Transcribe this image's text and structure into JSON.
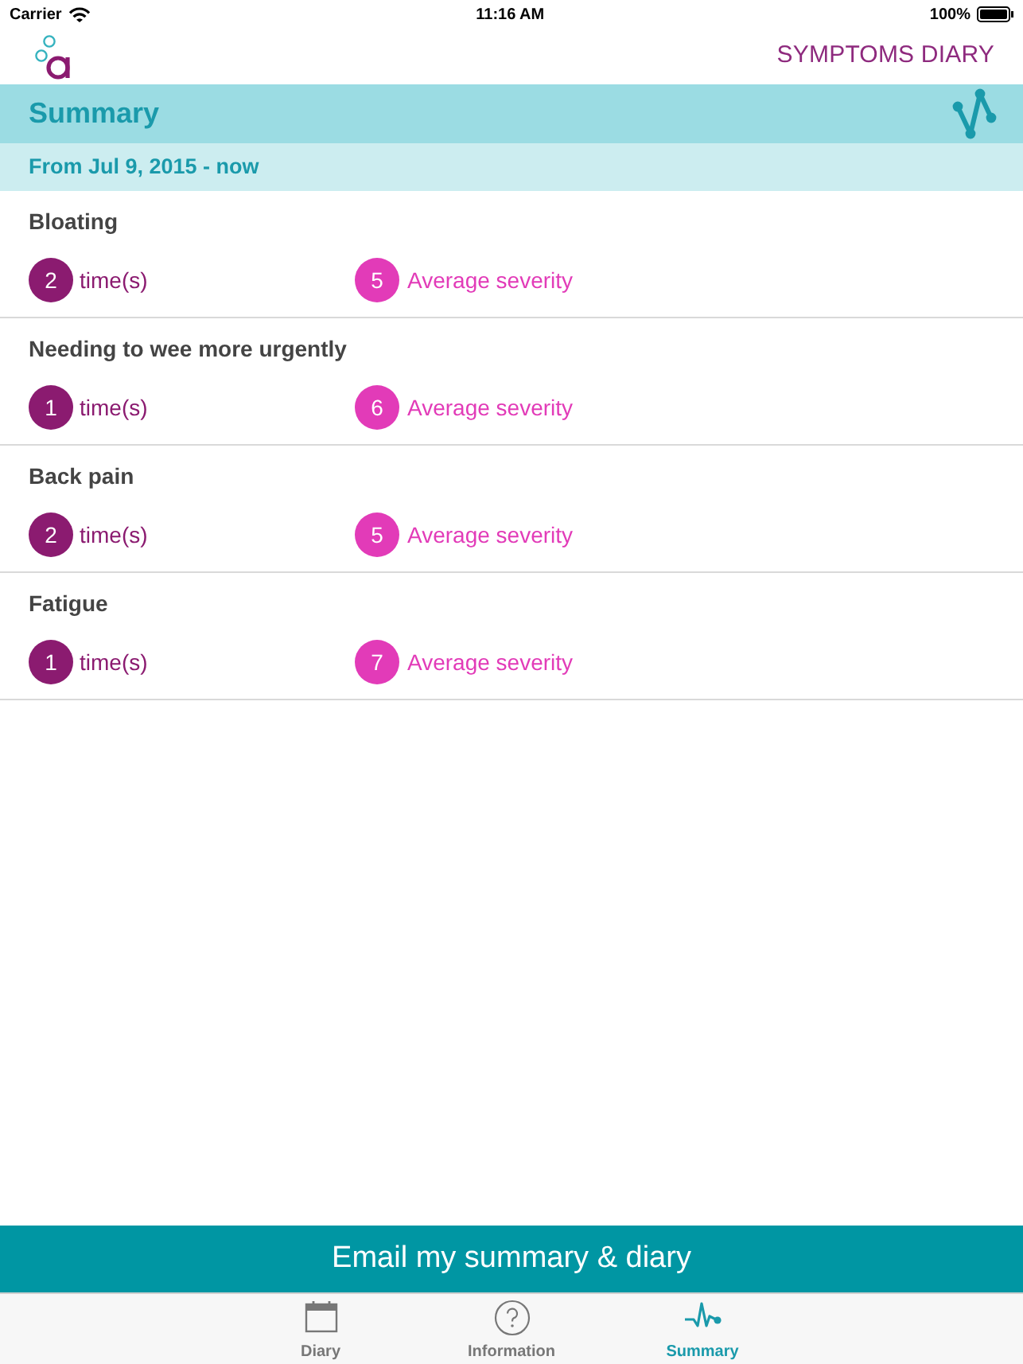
{
  "status_bar": {
    "carrier": "Carrier",
    "time": "11:16 AM",
    "battery": "100%"
  },
  "header": {
    "title": "SYMPTOMS DIARY"
  },
  "summary": {
    "title": "Summary",
    "range": "From Jul 9, 2015 - now"
  },
  "symptoms": [
    {
      "name": "Bloating",
      "count": "2",
      "count_label": "time(s)",
      "severity": "5",
      "severity_label": "Average severity"
    },
    {
      "name": "Needing to wee more urgently",
      "count": "1",
      "count_label": "time(s)",
      "severity": "6",
      "severity_label": "Average severity"
    },
    {
      "name": "Back pain",
      "count": "2",
      "count_label": "time(s)",
      "severity": "5",
      "severity_label": "Average severity"
    },
    {
      "name": "Fatigue",
      "count": "1",
      "count_label": "time(s)",
      "severity": "7",
      "severity_label": "Average severity"
    }
  ],
  "email_button": "Email my summary & diary",
  "tabs": [
    {
      "label": "Diary",
      "kind": "calendar",
      "selected": false
    },
    {
      "label": "Information",
      "kind": "help",
      "selected": false
    },
    {
      "label": "Summary",
      "kind": "pulse",
      "selected": true
    }
  ]
}
